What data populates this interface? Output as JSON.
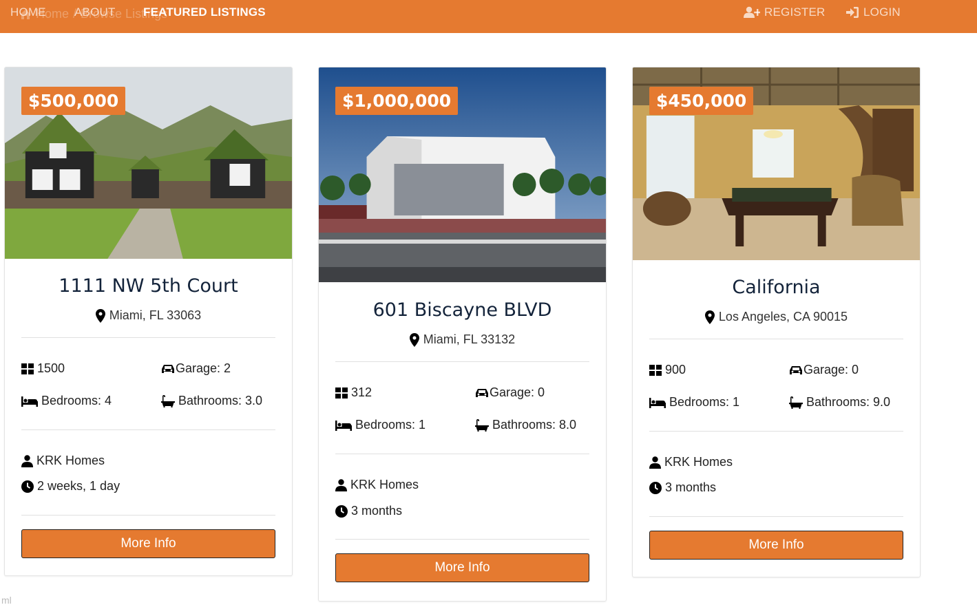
{
  "nav": {
    "home": "HOME",
    "about": "ABOUT",
    "featured": "FEATURED LISTINGS",
    "register": "REGISTER",
    "login": "LOGIN",
    "breadcrumb_home": "Home",
    "breadcrumb_sep": "/",
    "breadcrumb_current": "Browse Listings",
    "accent_color": "#e57a30"
  },
  "listings": [
    {
      "price": "$500,000",
      "title": "1111 NW 5th Court",
      "location": "Miami, FL 33063",
      "sqft": "1500",
      "garage": "Garage: 2",
      "bedrooms": "Bedrooms: 4",
      "bathrooms": "Bathrooms: 3.0",
      "realtor": "KRK Homes",
      "listed": "2 weeks, 1 day",
      "button": "More Info",
      "image": "turf-roof-houses-photo"
    },
    {
      "price": "$1,000,000",
      "title": "601 Biscayne BLVD",
      "location": "Miami, FL 33132",
      "sqft": "312",
      "garage": "Garage: 0",
      "bedrooms": "Bedrooms: 1",
      "bathrooms": "Bathrooms: 8.0",
      "realtor": "KRK Homes",
      "listed": "3 months",
      "button": "More Info",
      "image": "arena-building-photo"
    },
    {
      "price": "$450,000",
      "title": "California",
      "location": "Los Angeles, CA 90015",
      "sqft": "900",
      "garage": "Garage: 0",
      "bedrooms": "Bedrooms: 1",
      "bathrooms": "Bathrooms: 9.0",
      "realtor": "KRK Homes",
      "listed": "3 months",
      "button": "More Info",
      "image": "billiard-room-photo"
    }
  ],
  "footer_fragment": "ml",
  "icons": [
    "home-icon",
    "user-plus-icon",
    "sign-in-icon",
    "map-marker-icon",
    "th-large-icon",
    "car-icon",
    "bed-icon",
    "bath-icon",
    "user-icon",
    "clock-icon"
  ]
}
